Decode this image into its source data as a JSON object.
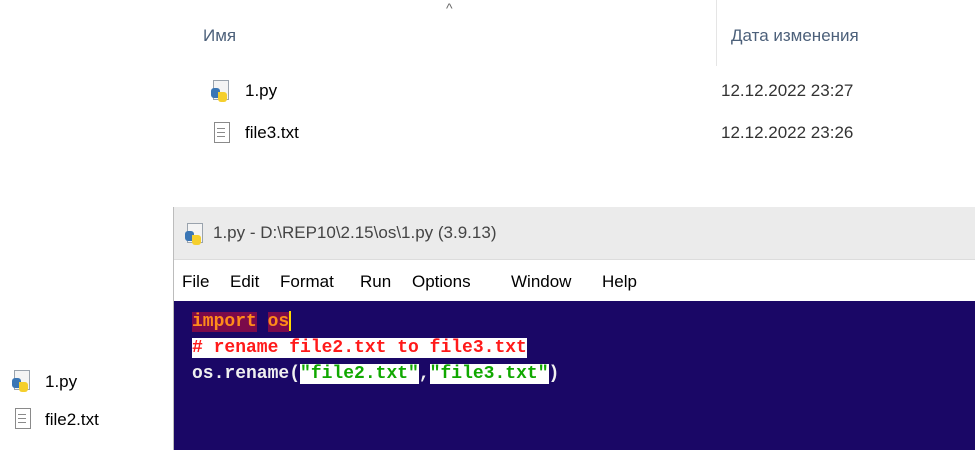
{
  "explorer": {
    "columns": {
      "name": "Имя",
      "date": "Дата изменения"
    },
    "sort_indicator": "^",
    "files": [
      {
        "name": "1.py",
        "date": "12.12.2022 23:27",
        "icon": "python-file-icon"
      },
      {
        "name": "file3.txt",
        "date": "12.12.2022 23:26",
        "icon": "text-file-icon"
      }
    ]
  },
  "left_files": [
    {
      "name": "1.py",
      "icon": "python-file-icon"
    },
    {
      "name": "file2.txt",
      "icon": "text-file-icon"
    }
  ],
  "idle": {
    "title": "1.py - D:\\REP10\\2.15\\os\\1.py (3.9.13)",
    "menu": [
      "File",
      "Edit",
      "Format",
      "Run",
      "Options",
      "Window",
      "Help"
    ],
    "code": {
      "line1": {
        "keyword": "import",
        "space": " ",
        "module": "os"
      },
      "line2": "# rename file2.txt to file3.txt",
      "line3": {
        "prefix": "os.rename(",
        "arg1": "\"file2.txt\"",
        "comma": ",",
        "arg2": "\"file3.txt\"",
        "suffix": ")"
      }
    }
  }
}
